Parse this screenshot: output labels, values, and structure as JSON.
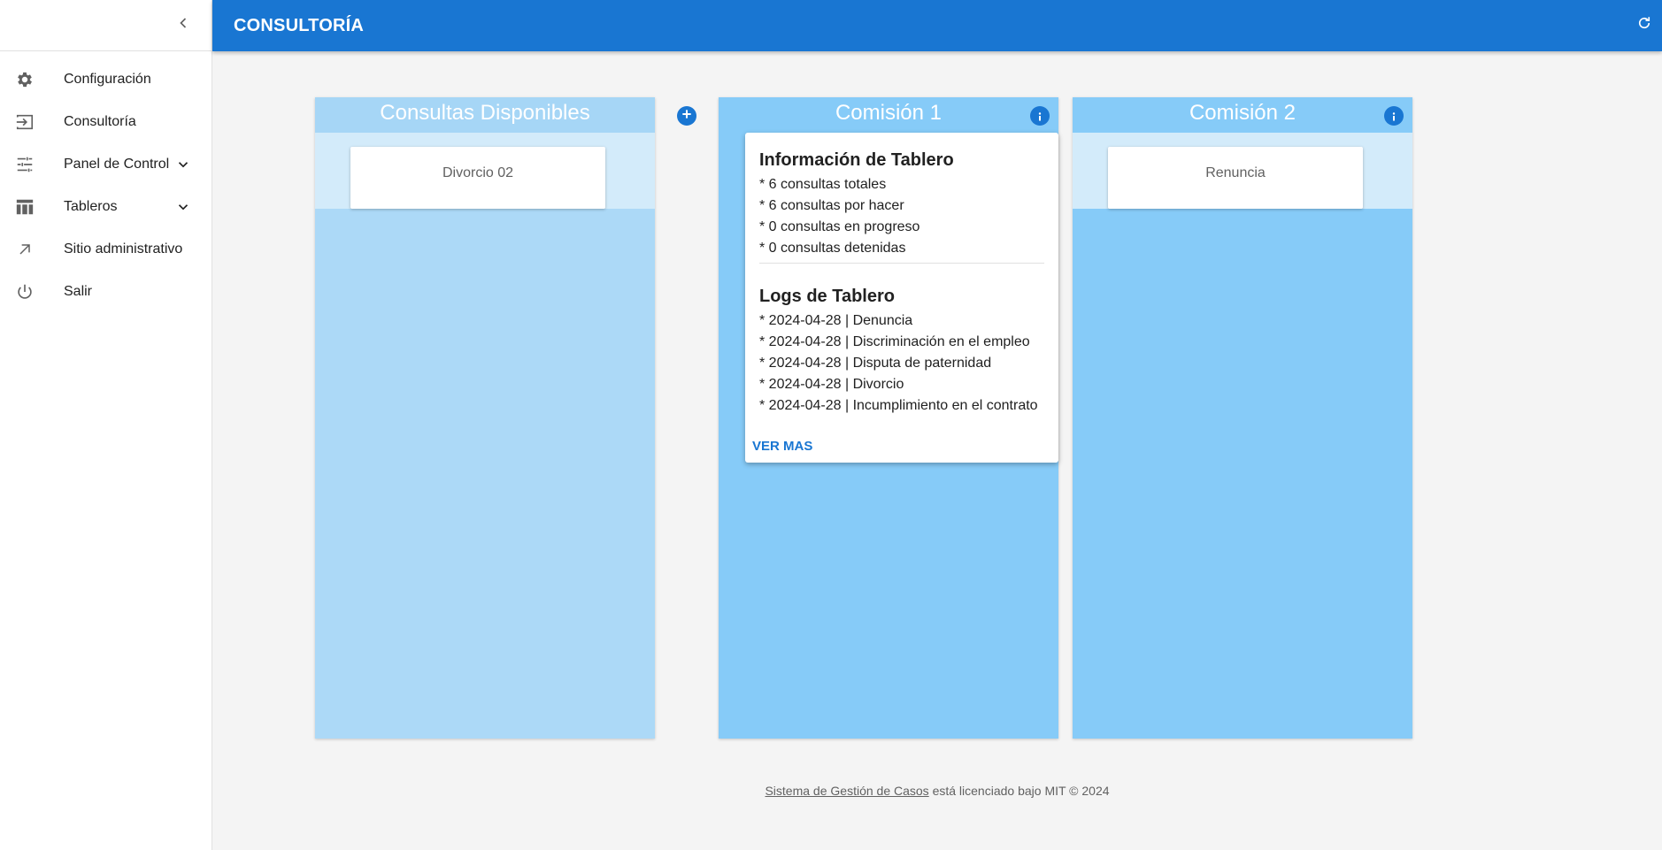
{
  "header": {
    "title": "CONSULTORÍA"
  },
  "sidebar": {
    "items": [
      {
        "label": "Configuración"
      },
      {
        "label": "Consultoría"
      },
      {
        "label": "Panel de Control"
      },
      {
        "label": "Tableros"
      },
      {
        "label": "Sitio administrativo"
      },
      {
        "label": "Salir"
      }
    ]
  },
  "columns": {
    "available": {
      "title": "Consultas Disponibles",
      "cards": [
        "Divorcio 02"
      ]
    },
    "c1": {
      "title": "Comisión 1"
    },
    "c2": {
      "title": "Comisión 2",
      "cards": [
        "Renuncia"
      ]
    }
  },
  "info_panel": {
    "info_title": "Información de Tablero",
    "info_lines": [
      "* 6 consultas totales",
      "* 6 consultas por hacer",
      "* 0 consultas en progreso",
      "* 0 consultas detenidas"
    ],
    "logs_title": "Logs de Tablero",
    "log_lines": [
      "* 2024-04-28 | Denuncia",
      "* 2024-04-28 | Discriminación en el empleo",
      "* 2024-04-28 | Disputa de paternidad",
      "* 2024-04-28 | Divorcio",
      "* 2024-04-28 | Incumplimiento en el contrato"
    ],
    "more_label": "VER MAS"
  },
  "footer": {
    "link_text": "Sistema de Gestión de Casos",
    "rest_text": " está licenciado bajo MIT © 2024"
  },
  "colors": {
    "primary": "#1976d2",
    "column": "#86cbf8",
    "available_column": "#acd9f7"
  },
  "icons": [
    "chevron-left-icon",
    "gear-icon",
    "login-icon",
    "tune-icon",
    "table-icon",
    "arrow-up-right-icon",
    "power-icon",
    "chevron-down-icon",
    "refresh-icon",
    "plus-icon",
    "info-icon"
  ]
}
